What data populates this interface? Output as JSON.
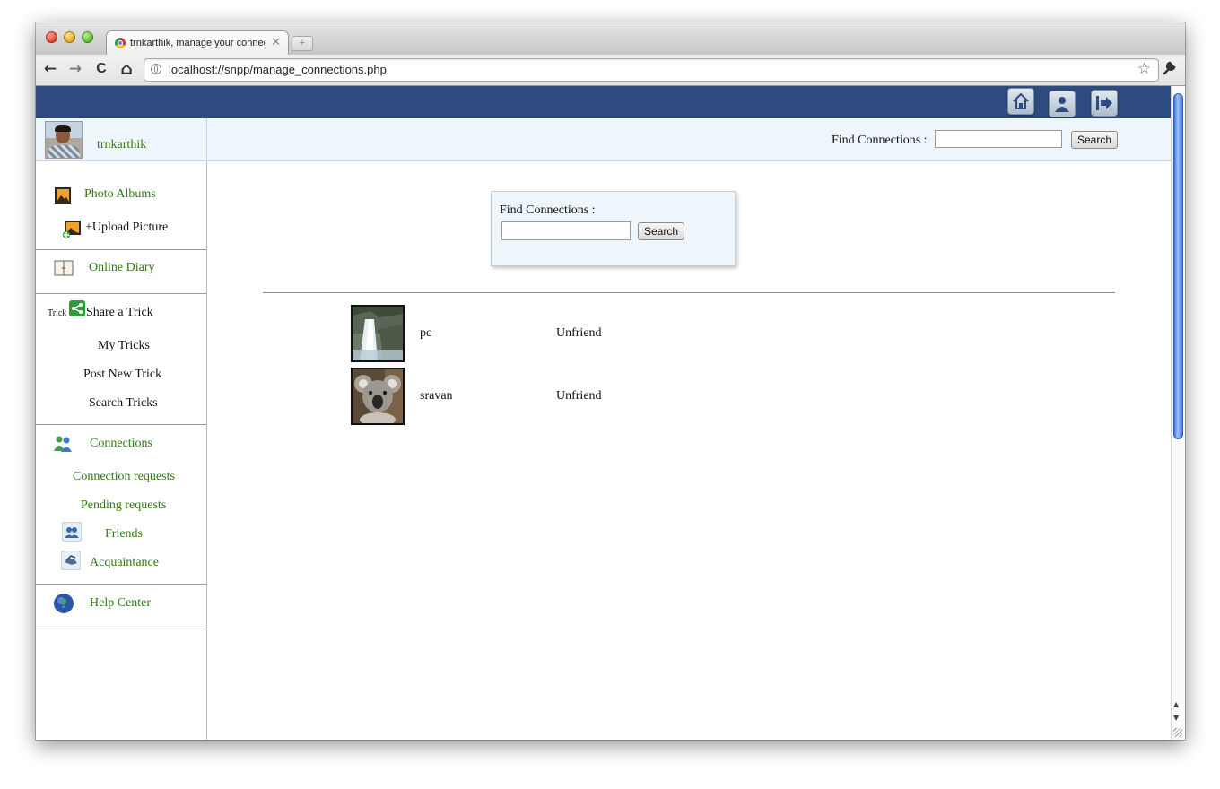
{
  "browser": {
    "tab_title": "trnkarthik, manage your connections",
    "tab_close": "✕",
    "new_tab": "+",
    "url": "localhost://snpp/manage_connections.php",
    "back": "←",
    "forward": "→",
    "reload": "C",
    "home": "⌂",
    "star": "☆",
    "wrench": "🔧"
  },
  "header": {
    "username": "trnkarthik",
    "find_label": "Find Connections :",
    "search_button": "Search",
    "icons": [
      "home-icon",
      "profile-icon",
      "logout-icon"
    ]
  },
  "sidebar": {
    "photo_albums": "Photo Albums",
    "upload_picture": "+Upload Picture",
    "online_diary": "Online Diary",
    "trick_label": "Trick",
    "share_trick": "Share a Trick",
    "my_tricks": "My Tricks",
    "post_new_trick": "Post New Trick",
    "search_tricks": "Search Tricks",
    "connections": "Connections",
    "connection_requests": "Connection requests",
    "pending_requests": "Pending requests",
    "friends": "Friends",
    "acquaintance": "Acquaintance",
    "help_center": "Help Center"
  },
  "main": {
    "find_box": {
      "label": "Find Connections :",
      "search_button": "Search"
    },
    "connections": [
      {
        "name": "pc",
        "action": "Unfriend",
        "picture": "waterfall"
      },
      {
        "name": "sravan",
        "action": "Unfriend",
        "picture": "koala"
      }
    ]
  },
  "colors": {
    "banner": "#2e4a7f",
    "subbar": "#eef5fb",
    "link_green": "#2f7a10"
  }
}
